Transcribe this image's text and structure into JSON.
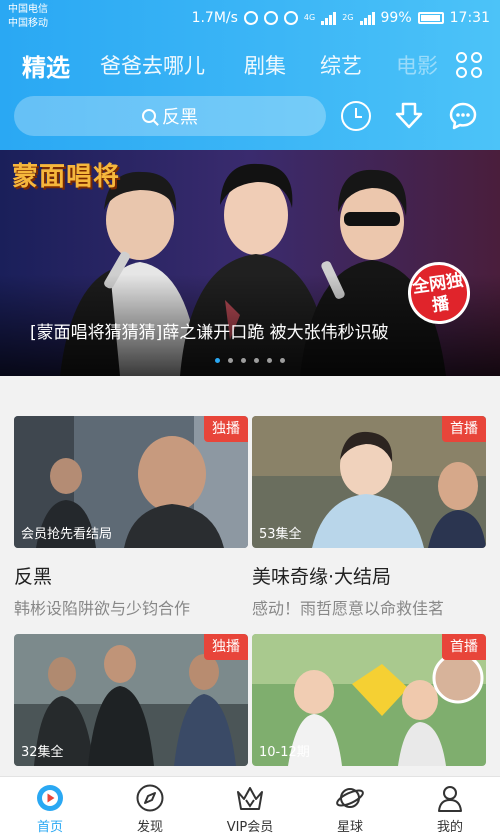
{
  "status_bar": {
    "carrier_1": "中国电信",
    "carrier_2": "中国移动",
    "speed": "1.7M/s",
    "net_1": "4G",
    "net_2": "2G",
    "battery": "99%",
    "time": "17:31"
  },
  "tabs": [
    "精选",
    "爸爸去哪儿",
    "剧集",
    "综艺",
    "电影"
  ],
  "search": {
    "placeholder": "反黑"
  },
  "banner": {
    "logo_text": "蒙面唱将",
    "caption": "[蒙面唱将猜猜猜]薛之谦开口跪 被大张伟秒识破",
    "badge": "全网独播",
    "page_count": 6,
    "active_page": 1
  },
  "cards": [
    {
      "tag": "独播",
      "overlay": "会员抢先看结局",
      "title": "反黑",
      "subtitle": "韩彬设陷阱欲与少钧合作"
    },
    {
      "tag": "首播",
      "overlay": "53集全",
      "title": "美味奇缘·大结局",
      "subtitle": "感动！雨哲愿意以命救佳茗"
    },
    {
      "tag": "独播",
      "overlay": "32集全",
      "title": "",
      "subtitle": ""
    },
    {
      "tag": "首播",
      "overlay": "10-12期",
      "title": "",
      "subtitle": ""
    }
  ],
  "bottom_nav": [
    {
      "label": "首页",
      "icon": "home-play-icon",
      "active": true
    },
    {
      "label": "发现",
      "icon": "compass-icon",
      "active": false
    },
    {
      "label": "VIP会员",
      "icon": "crown-icon",
      "active": false
    },
    {
      "label": "星球",
      "icon": "planet-icon",
      "active": false
    },
    {
      "label": "我的",
      "icon": "profile-icon",
      "active": false
    }
  ],
  "colors": {
    "accent": "#2aa8f3",
    "tag_red": "#e8453a"
  }
}
